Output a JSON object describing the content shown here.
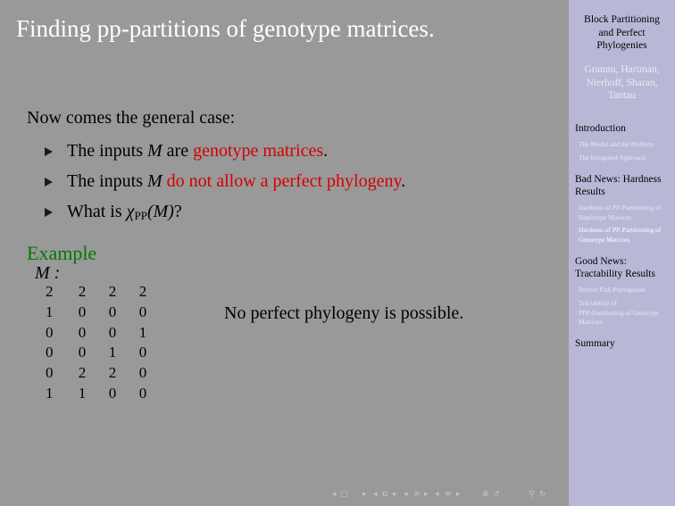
{
  "slide": {
    "title": "Finding pp-partitions of genotype matrices.",
    "intro": "Now comes the general case:",
    "bullets": [
      {
        "pre": "The inputs ",
        "var": "M",
        "mid": " are ",
        "highlight": "genotype matrices",
        "post": "."
      },
      {
        "pre": "The inputs ",
        "var": "M",
        "mid": " ",
        "highlight": "do not allow a perfect phylogeny",
        "post": "."
      },
      {
        "pre": "What is ",
        "chi": "χ",
        "chi_sub": "PP",
        "arg": "(M)",
        "post": "?"
      }
    ],
    "example": {
      "title": "Example",
      "matrix_label": "M :",
      "matrix": [
        [
          "2",
          "2",
          "2",
          "2"
        ],
        [
          "1",
          "0",
          "0",
          "0"
        ],
        [
          "0",
          "0",
          "0",
          "1"
        ],
        [
          "0",
          "0",
          "1",
          "0"
        ],
        [
          "0",
          "2",
          "2",
          "0"
        ],
        [
          "1",
          "1",
          "0",
          "0"
        ]
      ],
      "remark": "No perfect phylogeny is possible."
    }
  },
  "sidebar": {
    "title_lines": [
      "Block Partitioning",
      "and Perfect",
      "Phylogenies"
    ],
    "author_lines": [
      "Gramm, Hartman,",
      "Nierhoff, Sharan,",
      "Tantau"
    ],
    "sections": [
      {
        "title_lines": [
          "Introduction"
        ],
        "subsections": [
          {
            "lines": [
              "The Model and the Problem"
            ],
            "active": false
          },
          {
            "lines": [
              "The Integrated Approach"
            ],
            "active": false
          }
        ]
      },
      {
        "title_lines": [
          "Bad News: Hardness",
          "Results"
        ],
        "subsections": [
          {
            "lines": [
              "Hardness of PP-Partitioning of",
              "Haplotype Matrices"
            ],
            "active": false
          },
          {
            "lines": [
              "Hardness of PP-Partitioning of",
              "Genotype Matrices"
            ],
            "active": true
          }
        ]
      },
      {
        "title_lines": [
          "Good News:",
          "Tractability Results"
        ],
        "subsections": [
          {
            "lines": [
              "Perfect Path Phylogenies"
            ],
            "active": false
          },
          {
            "lines": [
              "Tractability of",
              "PPP-Partitioning of Genotype",
              "Matrices"
            ],
            "active": false
          }
        ]
      },
      {
        "title_lines": [
          "Summary"
        ],
        "subsections": []
      }
    ]
  },
  "navigation": {
    "icons": [
      "nav-left-arrow",
      "frame-icon",
      "nav-right-arrow",
      "nav-left-arrow",
      "subsection-icon",
      "nav-right-arrow",
      "nav-left-arrow",
      "section-icon",
      "nav-right-arrow",
      "nav-left-arrow",
      "doc-icon",
      "nav-right-arrow",
      "appendix-icon",
      "back-icon",
      "search-icon",
      "forward-icon"
    ],
    "glyphs": {
      "left": "◂",
      "right": "▸",
      "frame": "▢",
      "subsection": "⧉",
      "section": "≡",
      "doc": "≡",
      "appendix": "≣",
      "back": "↺",
      "search": "⚲",
      "forward": "↻"
    }
  },
  "colors": {
    "main_bg": "#999999",
    "sidebar_bg": "#b8b8d6",
    "title": "#ffffff",
    "alert": "#d40000",
    "example": "#007a00"
  }
}
